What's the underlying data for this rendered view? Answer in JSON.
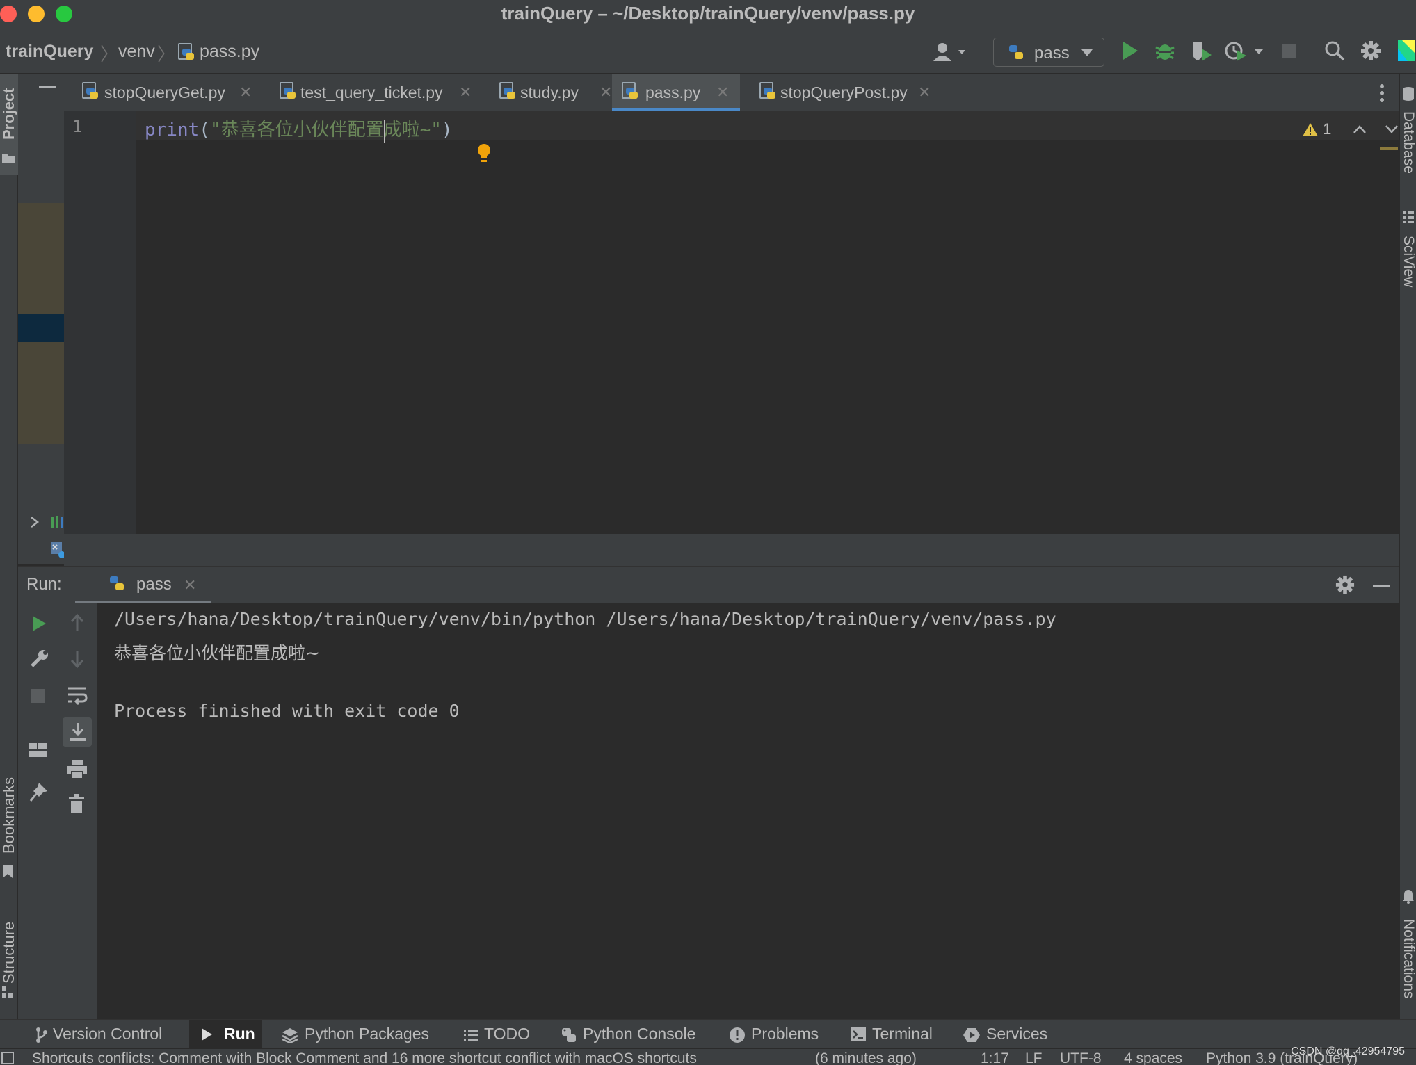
{
  "window": {
    "title": "trainQuery – ~/Desktop/trainQuery/venv/pass.py"
  },
  "breadcrumb": {
    "project": "trainQuery",
    "folder": "venv",
    "file": "pass.py"
  },
  "toolbar": {
    "run_config": "pass"
  },
  "tool_windows_left": {
    "project": "Project",
    "bookmarks": "Bookmarks",
    "structure": "Structure"
  },
  "tool_windows_right": {
    "database": "Database",
    "sciview": "SciView",
    "notifications": "Notifications"
  },
  "tabs": [
    {
      "label": "stopQueryGet.py",
      "active": false
    },
    {
      "label": "test_query_ticket.py",
      "active": false
    },
    {
      "label": "study.py",
      "active": false
    },
    {
      "label": "pass.py",
      "active": true
    },
    {
      "label": "stopQueryPost.py",
      "active": false
    }
  ],
  "editor": {
    "line_number": "1",
    "code_keyword": "print",
    "code_open": "(",
    "code_string_before_caret": "\"恭喜各位小伙伴配置",
    "code_string_after_caret": "成啦~\"",
    "code_close": ")",
    "warning_count": "1"
  },
  "run_panel": {
    "label": "Run:",
    "tab_label": "pass",
    "console": {
      "command": "/Users/hana/Desktop/trainQuery/venv/bin/python /Users/hana/Desktop/trainQuery/venv/pass.py",
      "output": "恭喜各位小伙伴配置成啦~",
      "exit_message": "Process finished with exit code 0"
    }
  },
  "bottom_tabs": [
    {
      "label": "Version Control",
      "icon": "branch-icon"
    },
    {
      "label": "Run",
      "icon": "run-icon",
      "active": true
    },
    {
      "label": "Python Packages",
      "icon": "layers-icon"
    },
    {
      "label": "TODO",
      "icon": "list-icon"
    },
    {
      "label": "Python Console",
      "icon": "python-icon"
    },
    {
      "label": "Problems",
      "icon": "problems-icon"
    },
    {
      "label": "Terminal",
      "icon": "terminal-icon"
    },
    {
      "label": "Services",
      "icon": "services-icon"
    }
  ],
  "status_bar": {
    "message": "Shortcuts conflicts: Comment with Block Comment and 16 more shortcut conflict with macOS shortcuts",
    "time_ago": "(6 minutes ago)",
    "position": "1:17",
    "line_separator": "LF",
    "encoding": "UTF-8",
    "indent": "4 spaces",
    "interpreter": "Python 3.9 (trainQuery)"
  },
  "watermark": "CSDN @qq_42954795",
  "colors": {
    "accent": "#4a88c7",
    "run_green": "#499c54",
    "keyword": "#8888c6",
    "string": "#6a8759",
    "background": "#2b2b2b",
    "panel": "#3c3f41"
  }
}
